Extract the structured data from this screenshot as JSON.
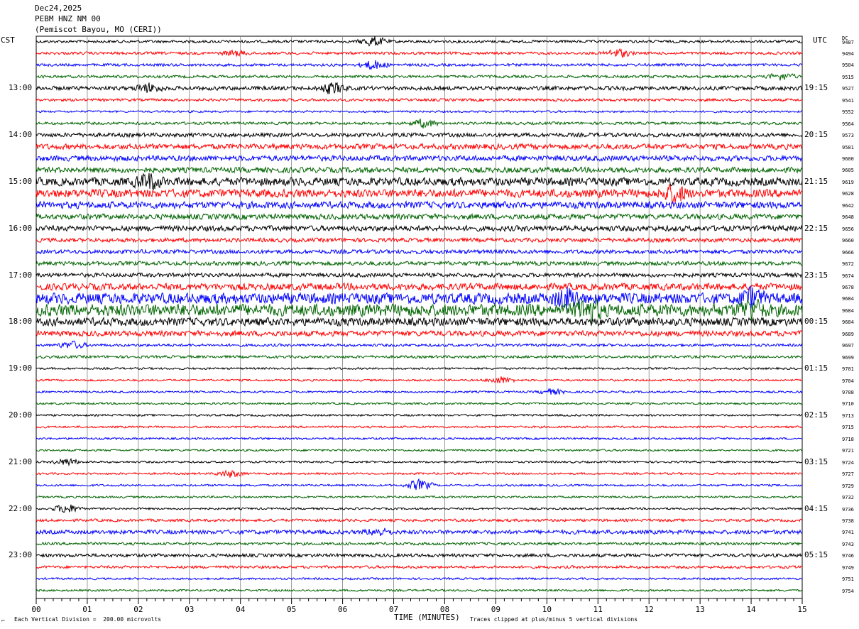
{
  "header": {
    "date": "Dec24,2025",
    "station": "PEBM HNZ NM 00",
    "location": "(Pemiscot Bayou, MO (CERI))"
  },
  "left_timezone": "CST",
  "right_timezone": "UTC",
  "dc_label": "DC",
  "footer": {
    "scale_note": "Each Vertical Division =  200.00 microvolts",
    "clip_note": "Traces clipped at plus/minus 5 vertical divisions",
    "corner_mark": "⌐"
  },
  "chart_data": {
    "type": "line",
    "xlabel": "TIME (MINUTES)",
    "xlim": [
      0,
      15
    ],
    "x_ticks": [
      "00",
      "01",
      "02",
      "03",
      "04",
      "05",
      "06",
      "07",
      "08",
      "09",
      "10",
      "11",
      "12",
      "13",
      "14",
      "15"
    ],
    "trace_colors": [
      "#000000",
      "#ff0000",
      "#0000ff",
      "#006400"
    ],
    "left_hour_labels": [
      {
        "row": 4,
        "text": "13:00"
      },
      {
        "row": 8,
        "text": "14:00"
      },
      {
        "row": 12,
        "text": "15:00"
      },
      {
        "row": 16,
        "text": "16:00"
      },
      {
        "row": 20,
        "text": "17:00"
      },
      {
        "row": 24,
        "text": "18:00"
      },
      {
        "row": 28,
        "text": "19:00"
      },
      {
        "row": 32,
        "text": "20:00"
      },
      {
        "row": 36,
        "text": "21:00"
      },
      {
        "row": 40,
        "text": "22:00"
      },
      {
        "row": 44,
        "text": "23:00"
      }
    ],
    "right_hour_labels": [
      {
        "row": 4,
        "text": "19:15"
      },
      {
        "row": 8,
        "text": "20:15"
      },
      {
        "row": 12,
        "text": "21:15"
      },
      {
        "row": 16,
        "text": "22:15"
      },
      {
        "row": 20,
        "text": "23:15"
      },
      {
        "row": 24,
        "text": "00:15"
      },
      {
        "row": 28,
        "text": "01:15"
      },
      {
        "row": 32,
        "text": "02:15"
      },
      {
        "row": 36,
        "text": "03:15"
      },
      {
        "row": 40,
        "text": "04:15"
      },
      {
        "row": 44,
        "text": "05:15"
      }
    ],
    "dc_offsets": [
      9487,
      9494,
      9504,
      9515,
      9527,
      9541,
      9552,
      9564,
      9573,
      9581,
      9600,
      9605,
      9619,
      9628,
      9642,
      9648,
      9656,
      9660,
      9666,
      9672,
      9674,
      9678,
      9684,
      9684,
      9684,
      9689,
      9697,
      9699,
      9701,
      9704,
      9708,
      9710,
      9713,
      9715,
      9718,
      9721,
      9724,
      9727,
      9729,
      9732,
      9736,
      9738,
      9741,
      9743,
      9746,
      9749,
      9751,
      9754
    ],
    "trace_noise_level": [
      2,
      2,
      2,
      2,
      3,
      2,
      1.5,
      2,
      3,
      4,
      4,
      4,
      6,
      6,
      5,
      4,
      4,
      3,
      3,
      3,
      3,
      5,
      8,
      9,
      6,
      4,
      2,
      2,
      1.5,
      1.5,
      1.5,
      1.5,
      1.5,
      1.5,
      1.5,
      1.5,
      1.5,
      1.5,
      1.5,
      1.5,
      1.5,
      2,
      3,
      2,
      2.5,
      2,
      1.5,
      1.5
    ],
    "events": [
      {
        "row": 0,
        "minute": 6.6,
        "amp": 7
      },
      {
        "row": 1,
        "minute": 11.4,
        "amp": 6
      },
      {
        "row": 1,
        "minute": 3.9,
        "amp": 4
      },
      {
        "row": 2,
        "minute": 6.6,
        "amp": 7
      },
      {
        "row": 3,
        "minute": 14.6,
        "amp": 5
      },
      {
        "row": 4,
        "minute": 5.8,
        "amp": 8
      },
      {
        "row": 4,
        "minute": 2.2,
        "amp": 6
      },
      {
        "row": 7,
        "minute": 7.6,
        "amp": 6
      },
      {
        "row": 12,
        "minute": 2.2,
        "amp": 10
      },
      {
        "row": 13,
        "minute": 12.5,
        "amp": 12
      },
      {
        "row": 22,
        "minute": 10.4,
        "amp": 14
      },
      {
        "row": 22,
        "minute": 14.0,
        "amp": 12
      },
      {
        "row": 23,
        "minute": 10.8,
        "amp": 16
      },
      {
        "row": 23,
        "minute": 14.0,
        "amp": 12
      },
      {
        "row": 26,
        "minute": 0.7,
        "amp": 5
      },
      {
        "row": 29,
        "minute": 9.1,
        "amp": 5
      },
      {
        "row": 30,
        "minute": 10.1,
        "amp": 4
      },
      {
        "row": 36,
        "minute": 0.6,
        "amp": 5
      },
      {
        "row": 37,
        "minute": 3.8,
        "amp": 5
      },
      {
        "row": 38,
        "minute": 7.5,
        "amp": 8
      },
      {
        "row": 40,
        "minute": 0.6,
        "amp": 7
      },
      {
        "row": 42,
        "minute": 6.7,
        "amp": 5
      }
    ]
  }
}
